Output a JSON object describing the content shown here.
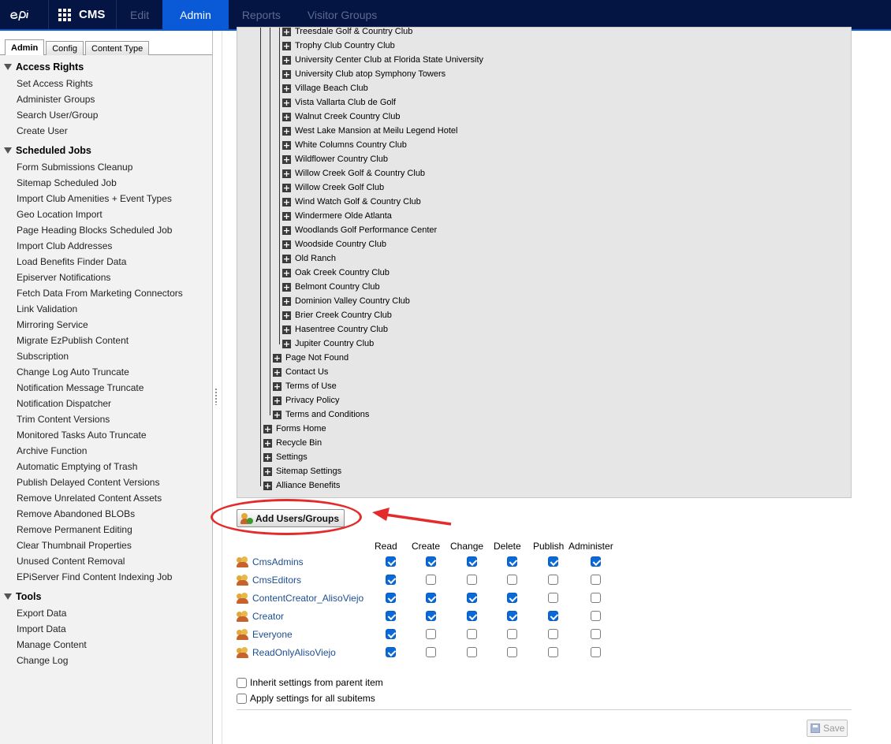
{
  "topbar": {
    "product": "CMS",
    "tabs": [
      {
        "label": "Edit",
        "active": false
      },
      {
        "label": "Admin",
        "active": true
      },
      {
        "label": "Reports",
        "active": false
      },
      {
        "label": "Visitor Groups",
        "active": false
      }
    ]
  },
  "left_tabs": [
    "Admin",
    "Config",
    "Content Type"
  ],
  "sidebar": {
    "groups": [
      {
        "title": "Access Rights",
        "items": [
          "Set Access Rights",
          "Administer Groups",
          "Search User/Group",
          "Create User"
        ]
      },
      {
        "title": "Scheduled Jobs",
        "items": [
          "Form Submissions Cleanup",
          "Sitemap Scheduled Job",
          "Import Club Amenities + Event Types",
          "Geo Location Import",
          "Page Heading Blocks Scheduled Job",
          "Import Club Addresses",
          "Load Benefits Finder Data",
          "Episerver Notifications",
          "Fetch Data From Marketing Connectors",
          "Link Validation",
          "Mirroring Service",
          "Migrate EzPublish Content",
          "Subscription",
          "Change Log Auto Truncate",
          "Notification Message Truncate",
          "Notification Dispatcher",
          "Trim Content Versions",
          "Monitored Tasks Auto Truncate",
          "Archive Function",
          "Automatic Emptying of Trash",
          "Publish Delayed Content Versions",
          "Remove Unrelated Content Assets",
          "Remove Abandoned BLOBs",
          "Remove Permanent Editing",
          "Clear Thumbnail Properties",
          "Unused Content Removal",
          "EPiServer Find Content Indexing Job"
        ]
      },
      {
        "title": "Tools",
        "items": [
          "Export Data",
          "Import Data",
          "Manage Content",
          "Change Log"
        ]
      }
    ]
  },
  "tree": {
    "level3": [
      "Treesdale Golf & Country Club",
      "Trophy Club Country Club",
      "University Center Club at Florida State University",
      "University Club atop Symphony Towers",
      "Village Beach Club",
      "Vista Vallarta Club de Golf",
      "Walnut Creek Country Club",
      "West Lake Mansion at Meilu Legend Hotel",
      "White Columns Country Club",
      "Wildflower Country Club",
      "Willow Creek Golf & Country Club",
      "Willow Creek Golf Club",
      "Wind Watch Golf & Country Club",
      "Windermere Olde Atlanta",
      "Woodlands Golf Performance Center",
      "Woodside Country Club",
      "Old Ranch",
      "Oak Creek Country Club",
      "Belmont Country Club",
      "Dominion Valley Country Club",
      "Brier Creek Country Club",
      "Hasentree Country Club",
      "Jupiter Country Club"
    ],
    "level2": [
      "Page Not Found",
      "Contact Us",
      "Terms of Use",
      "Privacy Policy",
      "Terms and Conditions"
    ],
    "level1": [
      "Forms Home",
      "Recycle Bin",
      "Settings",
      "Sitemap Settings",
      "Alliance Benefits"
    ]
  },
  "add_button_label": "Add Users/Groups",
  "permissions": {
    "columns": [
      "Read",
      "Create",
      "Change",
      "Delete",
      "Publish",
      "Administer"
    ],
    "rows": [
      {
        "name": "CmsAdmins",
        "values": [
          true,
          true,
          true,
          true,
          true,
          true
        ]
      },
      {
        "name": "CmsEditors",
        "values": [
          true,
          false,
          false,
          false,
          false,
          false
        ]
      },
      {
        "name": "ContentCreator_AlisoViejo",
        "values": [
          true,
          true,
          true,
          true,
          false,
          false
        ]
      },
      {
        "name": "Creator",
        "values": [
          true,
          true,
          true,
          true,
          true,
          false
        ]
      },
      {
        "name": "Everyone",
        "values": [
          true,
          false,
          false,
          false,
          false,
          false
        ]
      },
      {
        "name": "ReadOnlyAlisoViejo",
        "values": [
          true,
          false,
          false,
          false,
          false,
          false
        ]
      }
    ]
  },
  "options": {
    "inherit": {
      "label": "Inherit settings from parent item",
      "checked": false
    },
    "apply_all": {
      "label": "Apply settings for all subitems",
      "checked": false
    }
  },
  "save_label": "Save",
  "colors": {
    "nav_bg": "#041443",
    "nav_active": "#0a5ad8",
    "annotation": "#e42b2b",
    "checkbox": "#0a69d8",
    "link": "#1d4d94"
  }
}
